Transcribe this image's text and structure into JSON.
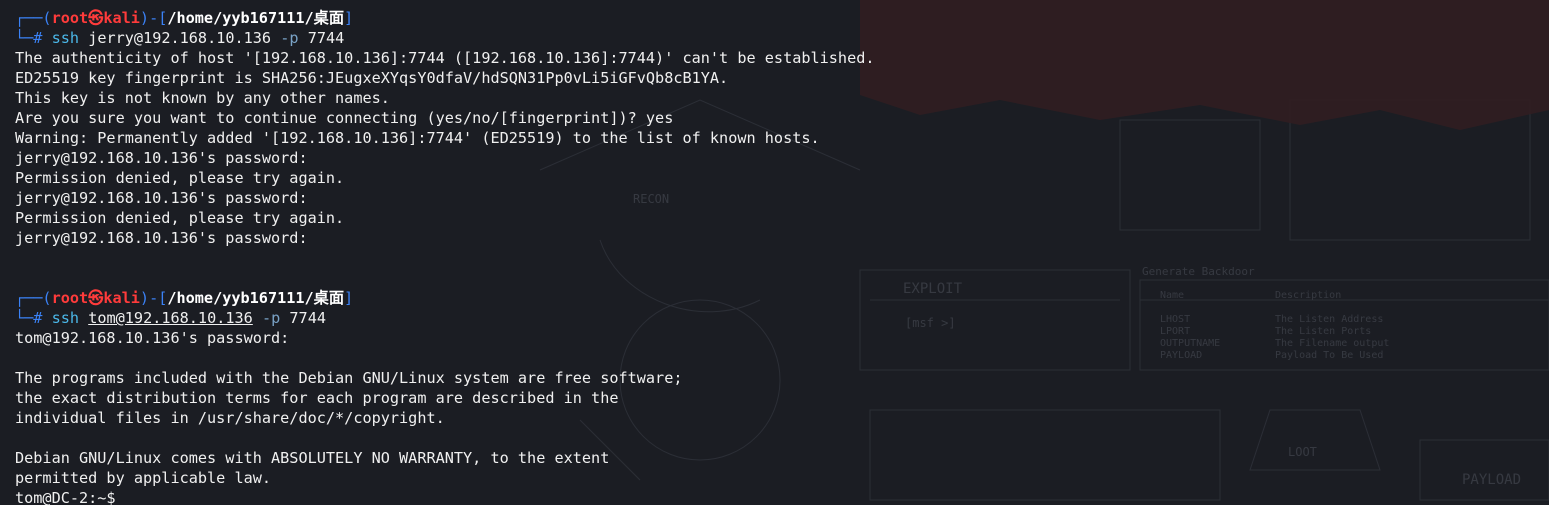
{
  "prompt": {
    "corner_top": "┌──(",
    "user": "root",
    "at_symbol": "㉿",
    "host": "kali",
    "sep": ")-[",
    "path": "/home/yyb167111/桌面",
    "close": "]",
    "corner_bottom": "└─",
    "hash": "#"
  },
  "session1": {
    "cmd": "ssh",
    "target": "jerry@192.168.10.136",
    "flag": "-p",
    "port": "7744",
    "output": [
      "The authenticity of host '[192.168.10.136]:7744 ([192.168.10.136]:7744)' can't be established.",
      "ED25519 key fingerprint is SHA256:JEugxeXYqsY0dfaV/hdSQN31Pp0vLi5iGFvQb8cB1YA.",
      "This key is not known by any other names.",
      "Are you sure you want to continue connecting (yes/no/[fingerprint])? yes",
      "Warning: Permanently added '[192.168.10.136]:7744' (ED25519) to the list of known hosts.",
      "jerry@192.168.10.136's password: ",
      "Permission denied, please try again.",
      "jerry@192.168.10.136's password: ",
      "Permission denied, please try again.",
      "jerry@192.168.10.136's password: "
    ]
  },
  "session2": {
    "cmd": "ssh",
    "target": "tom@192.168.10.136",
    "flag": "-p",
    "port": "7744",
    "output": [
      "tom@192.168.10.136's password: ",
      "",
      "The programs included with the Debian GNU/Linux system are free software;",
      "the exact distribution terms for each program are described in the",
      "individual files in /usr/share/doc/*/copyright.",
      "",
      "Debian GNU/Linux comes with ABSOLUTELY NO WARRANTY, to the extent",
      "permitted by applicable law."
    ],
    "final_prompt": "tom@DC-2:~$ "
  },
  "wallpaper": {
    "labels": [
      "RECON",
      "EXPLOIT",
      "[msf >]",
      "Generate Backdoor",
      "Name",
      "Description",
      "LHOST",
      "LPORT",
      "OUTPUTNAME",
      "PAYLOAD",
      "The Listen Address",
      "The Listen Ports",
      "The Filename output",
      "Payload To Be Used",
      "LOOT",
      "PAYLOAD"
    ],
    "accent": "#5a1e1e"
  }
}
